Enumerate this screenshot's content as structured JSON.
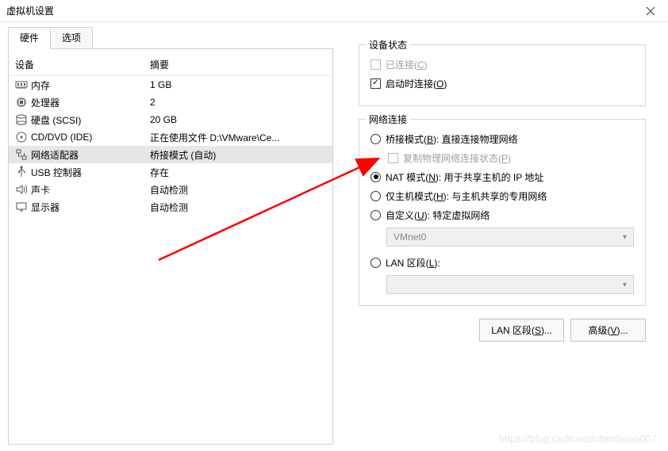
{
  "window": {
    "title": "虚拟机设置"
  },
  "tabs": {
    "hardware": "硬件",
    "options": "选项"
  },
  "columns": {
    "device": "设备",
    "summary": "摘要"
  },
  "devices": [
    {
      "icon": "memory",
      "name": "内存",
      "summary": "1 GB"
    },
    {
      "icon": "cpu",
      "name": "处理器",
      "summary": "2"
    },
    {
      "icon": "hdd",
      "name": "硬盘 (SCSI)",
      "summary": "20 GB"
    },
    {
      "icon": "disc",
      "name": "CD/DVD (IDE)",
      "summary": "正在使用文件 D:\\VMware\\Ce..."
    },
    {
      "icon": "network",
      "name": "网络适配器",
      "summary": "桥接模式 (自动)",
      "selected": true
    },
    {
      "icon": "usb",
      "name": "USB 控制器",
      "summary": "存在"
    },
    {
      "icon": "sound",
      "name": "声卡",
      "summary": "自动检测"
    },
    {
      "icon": "display",
      "name": "显示器",
      "summary": "自动检测"
    }
  ],
  "deviceStatus": {
    "group": "设备状态",
    "connected": "已连接(C)",
    "connectAtPowerOn": "启动时连接(O)"
  },
  "network": {
    "group": "网络连接",
    "bridged": "桥接模式(B): 直接连接物理网络",
    "replicate": "复制物理网络连接状态(P)",
    "nat": "NAT 模式(N): 用于共享主机的 IP 地址",
    "hostOnly": "仅主机模式(H): 与主机共享的专用网络",
    "custom": "自定义(U): 特定虚拟网络",
    "vmnet": "VMnet0",
    "lanSegment": "LAN 区段(L):"
  },
  "buttons": {
    "lanSegments": "LAN 区段(S)...",
    "advanced": "高级(V)..."
  },
  "watermark": "https://blog.csdn.net/chenlixiao007"
}
